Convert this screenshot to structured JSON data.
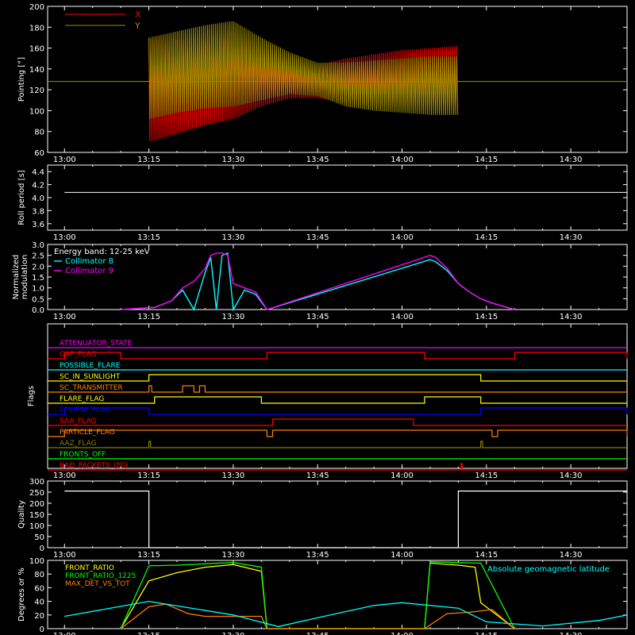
{
  "time_ticks": [
    "13:00",
    "13:15",
    "13:30",
    "13:45",
    "14:00",
    "14:15",
    "14:30"
  ],
  "chart_data": [
    {
      "type": "line",
      "ylabel": "Pointing [°]",
      "ylim": [
        60,
        200
      ],
      "yticks": [
        60,
        80,
        100,
        120,
        140,
        160,
        180,
        200
      ],
      "grid": false,
      "legend": "top-left",
      "legend_entries": [
        {
          "label": "X",
          "color": "#ff0000"
        },
        {
          "label": "Y",
          "color": "#a09000"
        }
      ],
      "baseline_value": 128,
      "active_window": [
        "13:15",
        "14:10"
      ],
      "series": [
        {
          "name": "X",
          "color": "#ff0000",
          "x": [
            "13:15",
            "13:20",
            "13:25",
            "13:30",
            "13:35",
            "13:40",
            "13:45",
            "13:50",
            "13:55",
            "14:00",
            "14:05",
            "14:10"
          ],
          "max": [
            168,
            168,
            170,
            176,
            160,
            148,
            144,
            150,
            154,
            158,
            160,
            162
          ],
          "min": [
            70,
            78,
            86,
            92,
            104,
            112,
            112,
            108,
            106,
            104,
            104,
            104
          ]
        },
        {
          "name": "Y",
          "color": "#a09000",
          "x": [
            "13:15",
            "13:20",
            "13:25",
            "13:30",
            "13:35",
            "13:40",
            "13:45",
            "13:50",
            "13:55",
            "14:00",
            "14:05",
            "14:10"
          ],
          "max": [
            170,
            176,
            182,
            186,
            170,
            156,
            146,
            146,
            148,
            150,
            152,
            152
          ],
          "min": [
            92,
            98,
            102,
            104,
            110,
            116,
            114,
            104,
            100,
            98,
            96,
            96
          ]
        }
      ]
    },
    {
      "type": "line",
      "ylabel": "Roll period [s]",
      "ylim": [
        3.5,
        4.5
      ],
      "yticks": [
        "3.6",
        "3.8",
        "4.0",
        "4.2",
        "4.4"
      ],
      "grid": false,
      "series": [
        {
          "name": "",
          "color": "#ffffff",
          "x": [
            "13:00",
            "14:40"
          ],
          "y": [
            4.08,
            4.08
          ]
        }
      ]
    },
    {
      "type": "line",
      "ylabel": "Normalized modulation",
      "ylim": [
        0,
        3.0
      ],
      "yticks": [
        "0.0",
        "0.5",
        "1.0",
        "1.5",
        "2.0",
        "2.5",
        "3.0"
      ],
      "grid": false,
      "legend": "top-left",
      "legend_title": "Energy band: 12-25 keV",
      "series": [
        {
          "name": "Collimator 8",
          "color": "#00ffff",
          "x": [
            "13:10",
            "13:16",
            "13:19",
            "13:21",
            "13:23",
            "13:25",
            "13:26",
            "13:27",
            "13:28",
            "13:29",
            "13:30",
            "13:32",
            "13:34",
            "13:36",
            "14:05",
            "14:06",
            "14:08",
            "14:10",
            "14:12",
            "14:14",
            "14:16",
            "14:20"
          ],
          "y": [
            0,
            0.1,
            0.4,
            0.9,
            0,
            1.7,
            2.4,
            0,
            2.5,
            2.6,
            0,
            0.9,
            0.7,
            0,
            2.3,
            2.2,
            1.8,
            1.2,
            0.8,
            0.5,
            0.3,
            0
          ]
        },
        {
          "name": "Collimator 9",
          "color": "#ff00ff",
          "x": [
            "13:10",
            "13:16",
            "13:19",
            "13:21",
            "13:23",
            "13:25",
            "13:26",
            "13:27",
            "13:28",
            "13:29",
            "13:30",
            "13:32",
            "13:34",
            "13:36",
            "14:05",
            "14:06",
            "14:08",
            "14:10",
            "14:12",
            "14:14",
            "14:16",
            "14:20"
          ],
          "y": [
            0,
            0.1,
            0.4,
            1.0,
            1.3,
            1.9,
            2.5,
            2.6,
            2.6,
            2.5,
            1.2,
            1.0,
            0.8,
            0,
            2.5,
            2.4,
            1.9,
            1.2,
            0.8,
            0.5,
            0.3,
            0
          ]
        }
      ]
    },
    {
      "type": "line",
      "ylabel": "Flags",
      "grid": false,
      "flags": [
        {
          "name": "ATTENUATOR_STATE",
          "color": "#ff00ff",
          "high": []
        },
        {
          "name": "GAP_FLAG",
          "color": "#ff0000",
          "high": [
            [
              "13:00",
              "13:10"
            ],
            [
              "13:36",
              "14:04"
            ],
            [
              "14:20",
              "14:40"
            ]
          ]
        },
        {
          "name": "POSSIBLE_FLARE",
          "color": "#00ffff",
          "high": []
        },
        {
          "name": "SC_IN_SUNLIGHT",
          "color": "#ffff00",
          "high": [
            [
              "13:15",
              "14:14"
            ]
          ]
        },
        {
          "name": "SC_TRANSMITTER",
          "color": "#ff8000",
          "high": [
            [
              "13:15",
              "13:15.5"
            ],
            [
              "13:21",
              "13:23"
            ],
            [
              "13:24",
              "13:25"
            ]
          ]
        },
        {
          "name": "FLARE_FLAG",
          "color": "#ffff00",
          "high": [
            [
              "13:16",
              "13:35"
            ],
            [
              "14:04",
              "14:14"
            ]
          ]
        },
        {
          "name": "ECLIPSE_FLAG",
          "color": "#0000ff",
          "high": [
            [
              "13:00",
              "13:15"
            ],
            [
              "14:14",
              "14:40"
            ]
          ]
        },
        {
          "name": "SAA_FLAG",
          "color": "#ff0000",
          "high": [
            [
              "13:37",
              "14:02"
            ]
          ]
        },
        {
          "name": "PARTICLE_FLAG",
          "color": "#ff8000",
          "high": [
            [
              "13:00",
              "13:36"
            ],
            [
              "13:37",
              "14:16"
            ],
            [
              "14:17",
              "14:40"
            ]
          ]
        },
        {
          "name": "AAZ_FLAG",
          "color": "#808000",
          "high": [
            [
              "13:15",
              "13:15.3"
            ],
            [
              "14:14",
              "14:14.3"
            ]
          ]
        },
        {
          "name": "FRONTS_OFF",
          "color": "#00ff00",
          "high": []
        },
        {
          "name": "BAD_PACKETS_(fill)",
          "color": "#ff0000",
          "high": [
            [
              "14:10.5",
              "14:10.7"
            ]
          ]
        }
      ]
    },
    {
      "type": "line",
      "ylabel": "Quality",
      "ylim": [
        0,
        300
      ],
      "yticks": [
        0,
        50,
        100,
        150,
        200,
        250,
        300
      ],
      "grid": false,
      "series": [
        {
          "name": "",
          "color": "#ffffff",
          "x": [
            "13:00",
            "13:15",
            "13:15",
            "14:10",
            "14:10",
            "14:40"
          ],
          "y": [
            255,
            255,
            0,
            0,
            255,
            255
          ]
        }
      ]
    },
    {
      "type": "line",
      "ylabel": "Degrees or %",
      "ylim": [
        0,
        100
      ],
      "yticks": [
        0,
        20,
        40,
        60,
        80,
        100
      ],
      "grid": false,
      "legend": "top-left",
      "extra_label": "Absolute geomagnetic latitude",
      "series": [
        {
          "name": "FRONT_RATIO",
          "color": "#ffff00",
          "x": [
            "13:10",
            "13:15",
            "13:20",
            "13:25",
            "13:30",
            "13:35",
            "13:36",
            "14:04",
            "14:05",
            "14:10",
            "14:13",
            "14:14",
            "14:20"
          ],
          "y": [
            0,
            70,
            82,
            90,
            94,
            84,
            0,
            0,
            96,
            93,
            90,
            38,
            0
          ]
        },
        {
          "name": "FRONT_RATIO_1225",
          "color": "#00ff00",
          "x": [
            "13:10",
            "13:15",
            "13:20",
            "13:25",
            "13:30",
            "13:35",
            "13:36",
            "14:04",
            "14:05",
            "14:10",
            "14:13",
            "14:14",
            "14:20"
          ],
          "y": [
            0,
            92,
            93,
            95,
            97,
            90,
            0,
            0,
            98,
            97,
            96,
            96,
            0
          ]
        },
        {
          "name": "MAX_DET_VS_TOT",
          "color": "#ff8000",
          "x": [
            "13:10",
            "13:15",
            "13:18",
            "13:22",
            "13:25",
            "13:30",
            "13:35",
            "13:36",
            "14:04",
            "14:08",
            "14:12",
            "14:16",
            "14:20"
          ],
          "y": [
            0,
            32,
            36,
            22,
            18,
            18,
            18,
            0,
            0,
            22,
            24,
            28,
            0
          ]
        },
        {
          "name": "Absolute geomagnetic latitude",
          "color": "#00ffff",
          "x": [
            "13:00",
            "13:15",
            "13:30",
            "13:38",
            "13:45",
            "13:55",
            "14:00",
            "14:10",
            "14:15",
            "14:25",
            "14:35",
            "14:40"
          ],
          "y": [
            18,
            40,
            20,
            3,
            16,
            34,
            38,
            30,
            10,
            4,
            12,
            20
          ]
        }
      ]
    }
  ]
}
